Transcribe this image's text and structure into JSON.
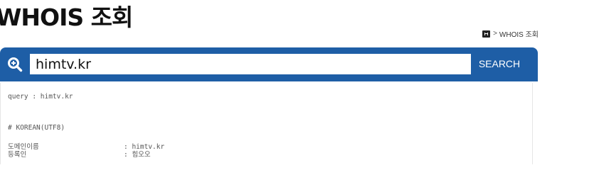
{
  "page": {
    "title": "WHOIS 조회"
  },
  "breadcrumb": {
    "separator": ">",
    "current": "WHOIS 조회"
  },
  "search": {
    "value": "himtv.kr",
    "button_label": "SEARCH"
  },
  "result": {
    "query_line": "query : himtv.kr",
    "charset_line": "# KOREAN(UTF8)",
    "fields": [
      {
        "label": "도메인이름",
        "value": ": himtv.kr"
      },
      {
        "label": "등록인",
        "value": ": 힘오오"
      }
    ]
  },
  "colors": {
    "accent": "#1e5ea6",
    "title_text": "#111111",
    "result_text": "#555555"
  },
  "icons": {
    "home": "home-icon",
    "search": "zoom-in-icon"
  }
}
